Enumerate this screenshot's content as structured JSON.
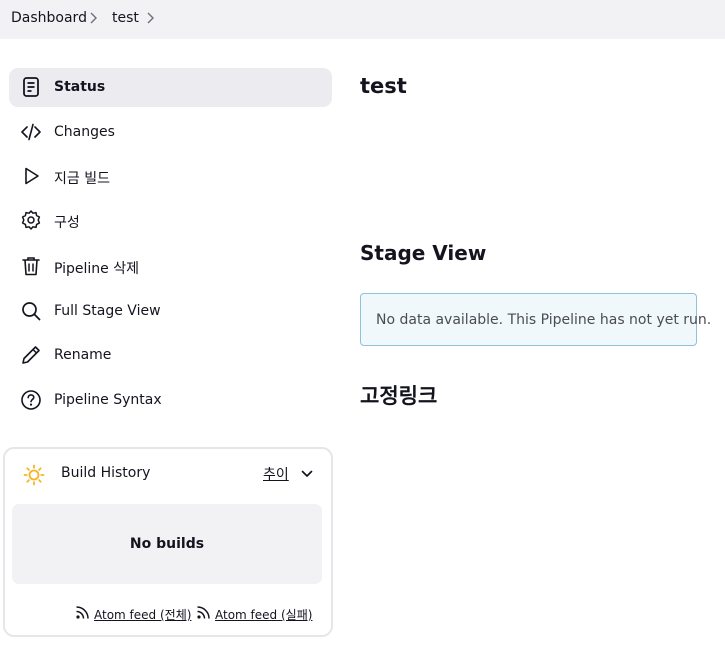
{
  "breadcrumb": {
    "items": [
      "Dashboard",
      "test"
    ]
  },
  "sidebar": {
    "items": [
      {
        "label": "Status",
        "icon": "status-icon",
        "active": true
      },
      {
        "label": "Changes",
        "icon": "code-icon"
      },
      {
        "label": "지금 빌드",
        "icon": "play-icon"
      },
      {
        "label": "구성",
        "icon": "gear-icon"
      },
      {
        "label": "Pipeline 삭제",
        "icon": "trash-icon"
      },
      {
        "label": "Full Stage View",
        "icon": "search-icon"
      },
      {
        "label": "Rename",
        "icon": "pencil-icon"
      },
      {
        "label": "Pipeline Syntax",
        "icon": "help-icon"
      }
    ]
  },
  "build_history": {
    "title": "Build History",
    "trend_label": "추이",
    "empty_text": "No builds",
    "feed_all": "Atom feed (전체)",
    "feed_failed": "Atom feed (실패)",
    "icon": "sun-icon"
  },
  "main": {
    "title": "test",
    "stage_view_title": "Stage View",
    "stage_view_message": "No data available. This Pipeline has not yet run.",
    "permalinks_title": "고정링크"
  },
  "colors": {
    "accent_bg": "#ebebf0",
    "topbar_bg": "#f2f2f5",
    "info_border": "#8fc1dc",
    "info_bg": "#f1f8fc",
    "sun": "#f5b622"
  }
}
